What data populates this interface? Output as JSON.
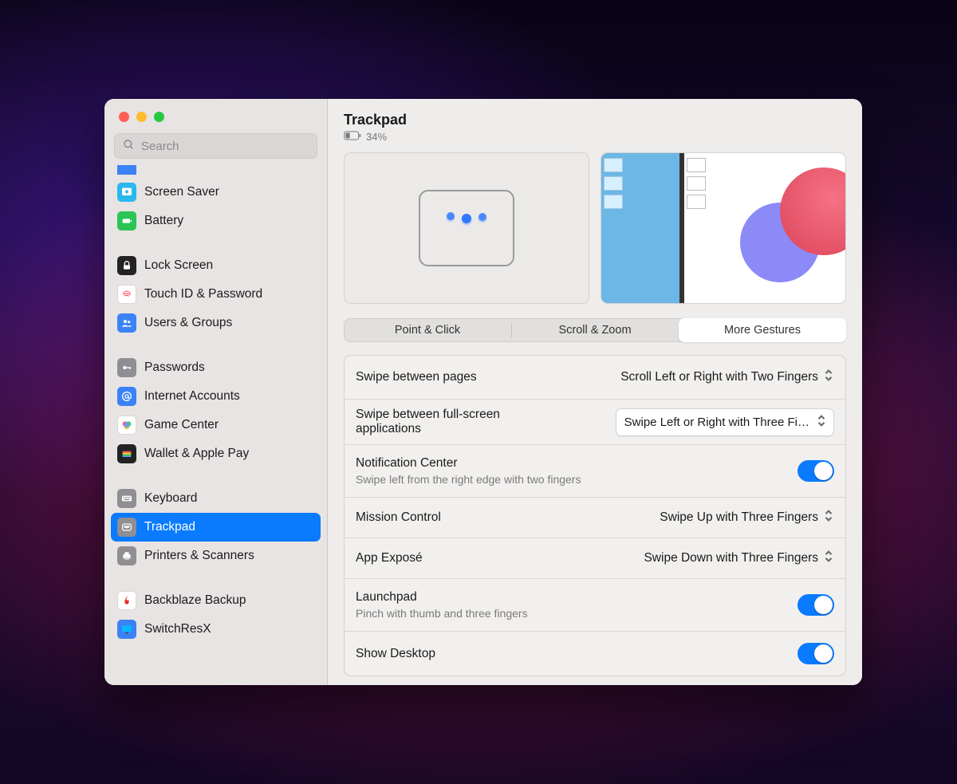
{
  "header": {
    "title": "Trackpad",
    "battery_percent": "34%"
  },
  "search": {
    "placeholder": "Search"
  },
  "sidebar": {
    "groups": [
      {
        "items": [
          {
            "label": "Screen Saver",
            "icon": "screen-saver-icon",
            "bg": "bg-cyan"
          },
          {
            "label": "Battery",
            "icon": "battery-icon",
            "bg": "bg-green"
          }
        ]
      },
      {
        "items": [
          {
            "label": "Lock Screen",
            "icon": "lock-icon",
            "bg": "bg-black"
          },
          {
            "label": "Touch ID & Password",
            "icon": "fingerprint-icon",
            "bg": "bg-white"
          },
          {
            "label": "Users & Groups",
            "icon": "users-icon",
            "bg": "bg-blue"
          }
        ]
      },
      {
        "items": [
          {
            "label": "Passwords",
            "icon": "key-icon",
            "bg": "bg-gray"
          },
          {
            "label": "Internet Accounts",
            "icon": "at-icon",
            "bg": "bg-blue"
          },
          {
            "label": "Game Center",
            "icon": "game-center-icon",
            "bg": "bg-white"
          },
          {
            "label": "Wallet & Apple Pay",
            "icon": "wallet-icon",
            "bg": "bg-black"
          }
        ]
      },
      {
        "items": [
          {
            "label": "Keyboard",
            "icon": "keyboard-icon",
            "bg": "bg-gray"
          },
          {
            "label": "Trackpad",
            "icon": "trackpad-icon",
            "bg": "bg-gray",
            "selected": true
          },
          {
            "label": "Printers & Scanners",
            "icon": "printer-icon",
            "bg": "bg-gray"
          }
        ]
      },
      {
        "items": [
          {
            "label": "Backblaze Backup",
            "icon": "flame-icon",
            "bg": "bg-white"
          },
          {
            "label": "SwitchResX",
            "icon": "display-icon",
            "bg": "bg-blue"
          }
        ]
      }
    ]
  },
  "tabs": {
    "items": [
      "Point & Click",
      "Scroll & Zoom",
      "More Gestures"
    ],
    "active_index": 2
  },
  "settings": {
    "rows": [
      {
        "label": "Swipe between pages",
        "type": "select-plain",
        "value": "Scroll Left or Right with Two Fingers"
      },
      {
        "label": "Swipe between full-screen applications",
        "type": "select-pill",
        "value": "Swipe Left or Right with Three Fi…"
      },
      {
        "label": "Notification Center",
        "sub": "Swipe left from the right edge with two fingers",
        "type": "toggle",
        "on": true
      },
      {
        "label": "Mission Control",
        "type": "select-plain",
        "value": "Swipe Up with Three Fingers"
      },
      {
        "label": "App Exposé",
        "type": "select-plain",
        "value": "Swipe Down with Three Fingers"
      },
      {
        "label": "Launchpad",
        "sub": "Pinch with thumb and three fingers",
        "type": "toggle",
        "on": true
      },
      {
        "label": "Show Desktop",
        "type": "toggle",
        "on": true
      }
    ]
  }
}
